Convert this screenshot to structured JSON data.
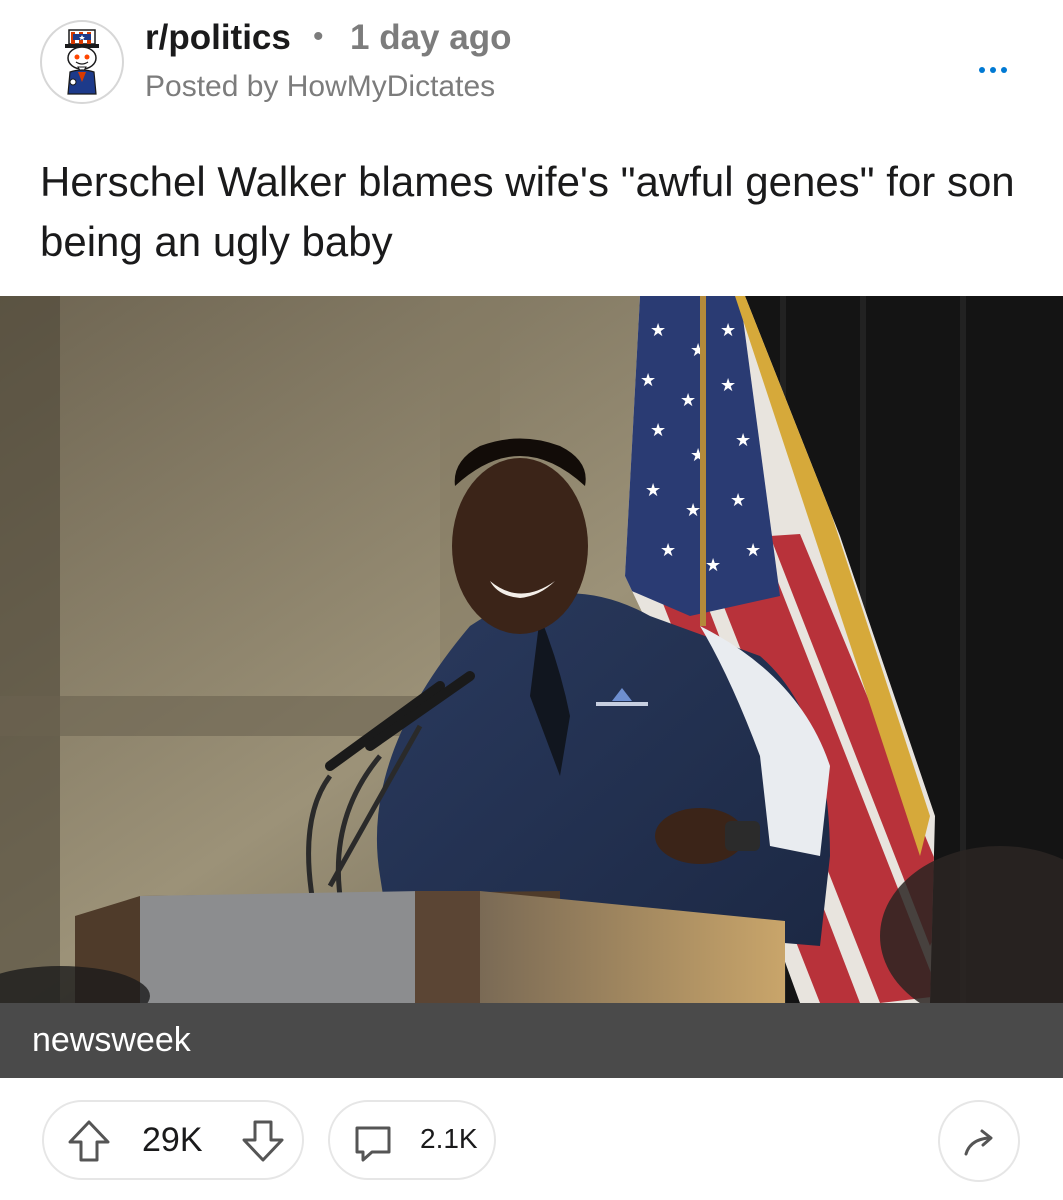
{
  "post": {
    "subreddit": "r/politics",
    "separator": "•",
    "time_ago": "1 day ago",
    "posted_by": "Posted by HowMyDictates",
    "title": "Herschel Walker blames wife's \"awful genes\" for son being an ugly baby",
    "link_source": "newsweek",
    "upvotes": "29K",
    "comments": "2.1K"
  },
  "icons": {
    "avatar": "uncle-sam-snoo-icon",
    "more": "more-options-icon",
    "upvote": "upvote-arrow-icon",
    "downvote": "downvote-arrow-icon",
    "comment": "comment-bubble-icon",
    "share": "share-arrow-icon"
  },
  "colors": {
    "accent": "#0079d3",
    "muted_text": "#7c7c7c",
    "caption_bar": "#4a4a4a"
  }
}
